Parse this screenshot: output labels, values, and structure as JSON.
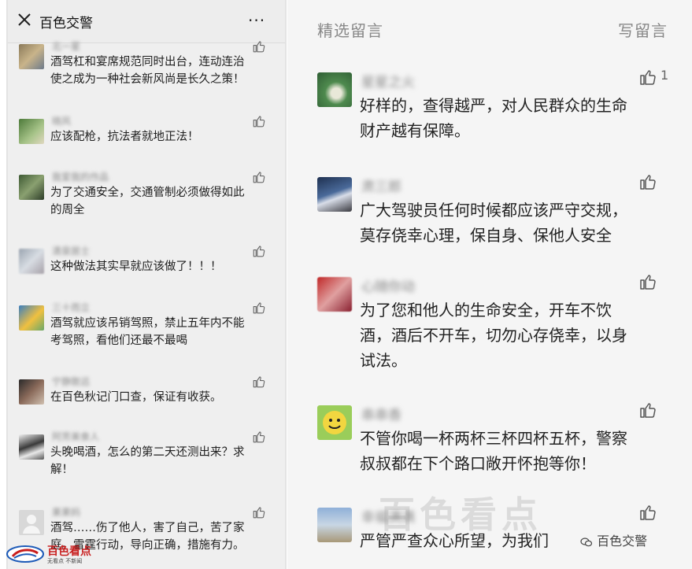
{
  "left": {
    "topbar": {
      "title": "百色交警",
      "more": "···"
    },
    "comments": [
      {
        "name": "北一星",
        "text": "酒驾杠和宴席规范同时出台，连动连治\n使之成为一种社会新风尚是长久之策！"
      },
      {
        "name": "晓风",
        "text": "应该配枪，抗法者就地正法！"
      },
      {
        "name": "我爱我的作品",
        "text": "为了交通安全，交通管制必须做得如此\n的周全"
      },
      {
        "name": "清泉居士",
        "text": "这种做法其实早就应该做了！！！"
      },
      {
        "name": "三十而立",
        "text": "酒驾就应该吊销驾照，禁止五年内不能\n考驾照，看他们还最不最喝"
      },
      {
        "name": "宁静致远",
        "text": "在百色秋记门口查，保证有收获。"
      },
      {
        "name": "阿芳美食人",
        "text": "头晚喝酒，怎么的第二天还测出来？求\n解！"
      },
      {
        "name": "果果妈",
        "text": "酒驾……伤了他人，害了自己，苦了家\n庭。雷霆行动，导向正确，措施有力。"
      }
    ],
    "logo": {
      "name": "百色看点",
      "sub": "无看点 不新闻"
    }
  },
  "right": {
    "header": {
      "title": "精选留言",
      "action": "写留言"
    },
    "comments": [
      {
        "name": "星星之火",
        "text": "好样的，查得越严，对人民群众的生命\n财产越有保障。",
        "likes": "1"
      },
      {
        "name": "肃三郎",
        "text": "广大驾驶员任何时候都应该严守交规，\n莫存侥幸心理，保自身、保他人安全",
        "likes": ""
      },
      {
        "name": "心随你动",
        "text": "为了您和他人的生命安全，开车不饮\n酒，酒后不开车，切勿心存侥幸，以身\n试法。",
        "likes": ""
      },
      {
        "name": "串串香",
        "text": "不管你喝一杯两杯三杯四杯五杯，警察\n叔叔都在下个路口敞开怀抱等你！",
        "likes": ""
      },
      {
        "name": "幸福满满",
        "text": "严管严查众心所望，为我们",
        "likes": ""
      }
    ],
    "watermark": "百色看点",
    "corner_watermark": "百色交警"
  },
  "colors": {
    "brand_red": "#c81e1e",
    "text": "#222222",
    "muted": "#888888"
  }
}
